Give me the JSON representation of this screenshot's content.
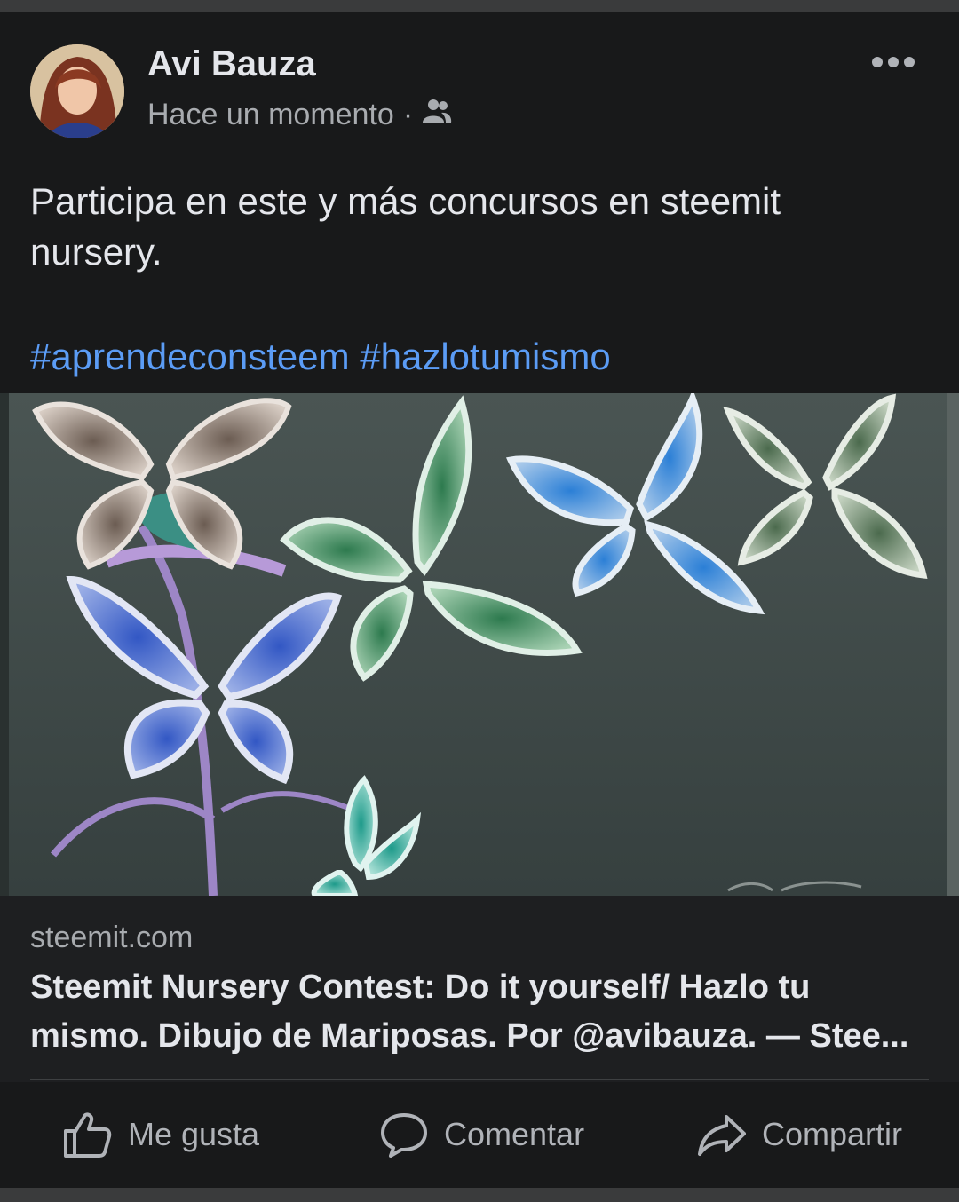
{
  "post": {
    "author": "Avi Bauza",
    "time": "Hace un momento",
    "separator": "·",
    "audience_icon": "friends-icon",
    "text_line1": "Participa en este y más concursos en steemit",
    "text_line2": "nursery.",
    "hashtags": [
      "#aprendeconsteem",
      "#hazlotumismo"
    ]
  },
  "link_preview": {
    "domain": "steemit.com",
    "title_line1": "Steemit Nursery Contest: Do it yourself/ Hazlo tu",
    "title_line2": "mismo. Dibujo de Mariposas. Por @avibauza. — Stee..."
  },
  "actions": {
    "like": "Me gusta",
    "comment": "Comentar",
    "share": "Compartir"
  },
  "colors": {
    "background": "#18191a",
    "link": "#5b9cf5",
    "text": "#e4e6eb",
    "secondary": "#b0b3b8"
  }
}
